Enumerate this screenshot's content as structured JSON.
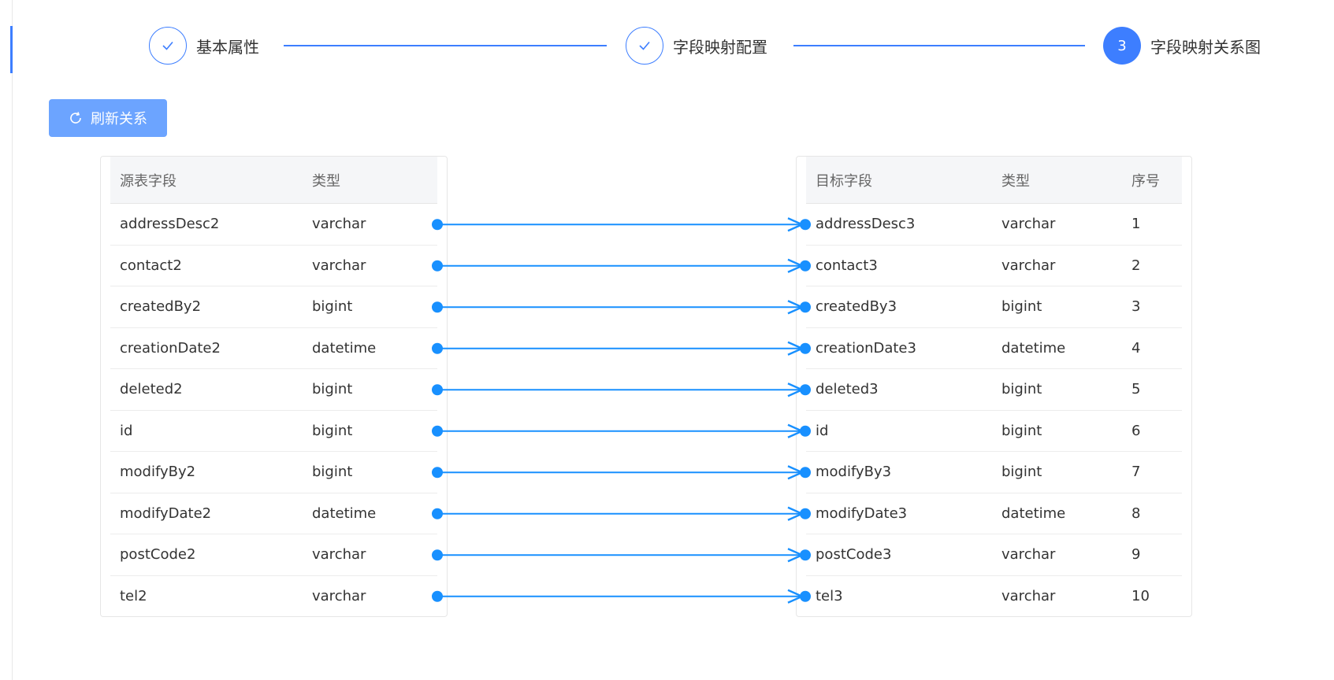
{
  "steps": [
    {
      "label": "基本属性",
      "state": "done"
    },
    {
      "label": "字段映射配置",
      "state": "done"
    },
    {
      "label": "字段映射关系图",
      "number": "3",
      "state": "active"
    }
  ],
  "toolbar": {
    "refresh_label": "刷新关系",
    "refresh_icon": "refresh-icon"
  },
  "source_table": {
    "headers": {
      "name": "源表字段",
      "type": "类型"
    },
    "rows": [
      {
        "name": "addressDesc2",
        "type": "varchar"
      },
      {
        "name": "contact2",
        "type": "varchar"
      },
      {
        "name": "createdBy2",
        "type": "bigint"
      },
      {
        "name": "creationDate2",
        "type": "datetime"
      },
      {
        "name": "deleted2",
        "type": "bigint"
      },
      {
        "name": "id",
        "type": "bigint"
      },
      {
        "name": "modifyBy2",
        "type": "bigint"
      },
      {
        "name": "modifyDate2",
        "type": "datetime"
      },
      {
        "name": "postCode2",
        "type": "varchar"
      },
      {
        "name": "tel2",
        "type": "varchar"
      }
    ]
  },
  "target_table": {
    "headers": {
      "name": "目标字段",
      "type": "类型",
      "seq": "序号"
    },
    "rows": [
      {
        "name": "addressDesc3",
        "type": "varchar",
        "seq": "1"
      },
      {
        "name": "contact3",
        "type": "varchar",
        "seq": "2"
      },
      {
        "name": "createdBy3",
        "type": "bigint",
        "seq": "3"
      },
      {
        "name": "creationDate3",
        "type": "datetime",
        "seq": "4"
      },
      {
        "name": "deleted3",
        "type": "bigint",
        "seq": "5"
      },
      {
        "name": "id",
        "type": "bigint",
        "seq": "6"
      },
      {
        "name": "modifyBy3",
        "type": "bigint",
        "seq": "7"
      },
      {
        "name": "modifyDate3",
        "type": "datetime",
        "seq": "8"
      },
      {
        "name": "postCode3",
        "type": "varchar",
        "seq": "9"
      },
      {
        "name": "tel3",
        "type": "varchar",
        "seq": "10"
      }
    ]
  },
  "mappings": [
    [
      0,
      0
    ],
    [
      1,
      1
    ],
    [
      2,
      2
    ],
    [
      3,
      3
    ],
    [
      4,
      4
    ],
    [
      5,
      5
    ],
    [
      6,
      6
    ],
    [
      7,
      7
    ],
    [
      8,
      8
    ],
    [
      9,
      9
    ]
  ],
  "colors": {
    "accent": "#3d7eff",
    "connector": "#1890ff",
    "button": "#6ca4ff"
  }
}
